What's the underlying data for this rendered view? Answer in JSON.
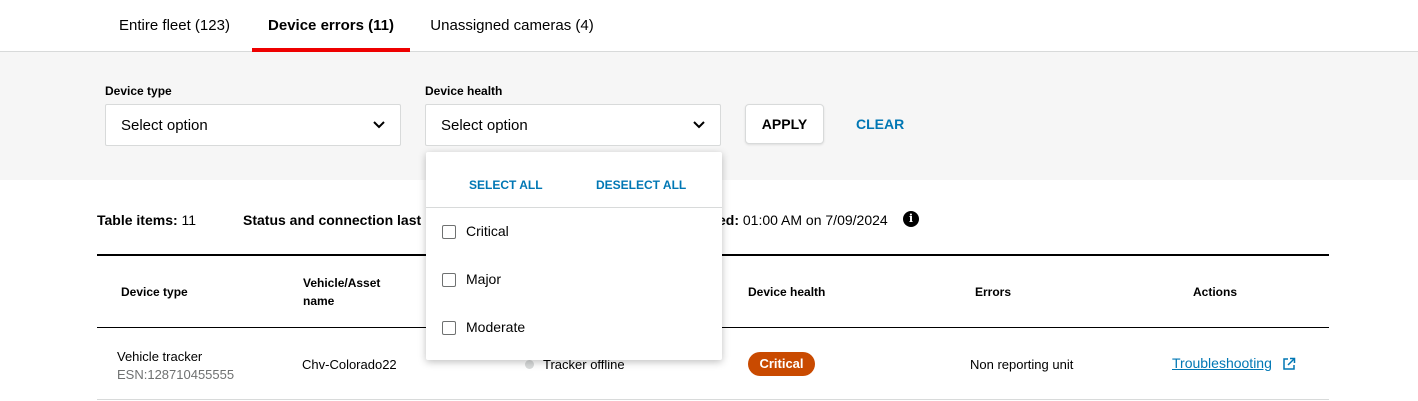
{
  "tabs": [
    {
      "label": "Entire fleet (123)",
      "active": false
    },
    {
      "label": "Device errors (11)",
      "active": true
    },
    {
      "label": "Unassigned cameras (4)",
      "active": false
    }
  ],
  "filters": {
    "device_type": {
      "label": "Device type",
      "placeholder": "Select option"
    },
    "device_health": {
      "label": "Device health",
      "placeholder": "Select option"
    },
    "apply_label": "APPLY",
    "clear_label": "CLEAR"
  },
  "dropdown": {
    "select_all": "SELECT ALL",
    "deselect_all": "DESELECT ALL",
    "options": [
      {
        "label": "Critical",
        "checked": false
      },
      {
        "label": "Major",
        "checked": false
      },
      {
        "label": "Moderate",
        "checked": false
      }
    ]
  },
  "table_meta": {
    "items_label": "Table items:",
    "items_count": "11",
    "status_label_start": "Status and connection last",
    "status_label_end": "ed:",
    "status_time": "01:00 AM on 7/09/2024",
    "info_icon": "info-icon"
  },
  "table": {
    "headers": {
      "device_type": "Device type",
      "vehicle_asset_name_line1": "Vehicle/Asset",
      "vehicle_asset_name_line2": "name",
      "device_health": "Device health",
      "errors": "Errors",
      "actions": "Actions"
    },
    "rows": [
      {
        "device_type": "Vehicle tracker",
        "esn": "ESN:128710455555",
        "vehicle_name": "Chv-Colorado22",
        "status": "Tracker offline",
        "health": "Critical",
        "errors": "Non reporting unit",
        "action": "Troubleshooting"
      }
    ]
  },
  "colors": {
    "accent_red": "#ee0000",
    "link_blue": "#0077b4",
    "critical_badge": "#c94a00",
    "filter_bg": "#f6f6f6"
  }
}
